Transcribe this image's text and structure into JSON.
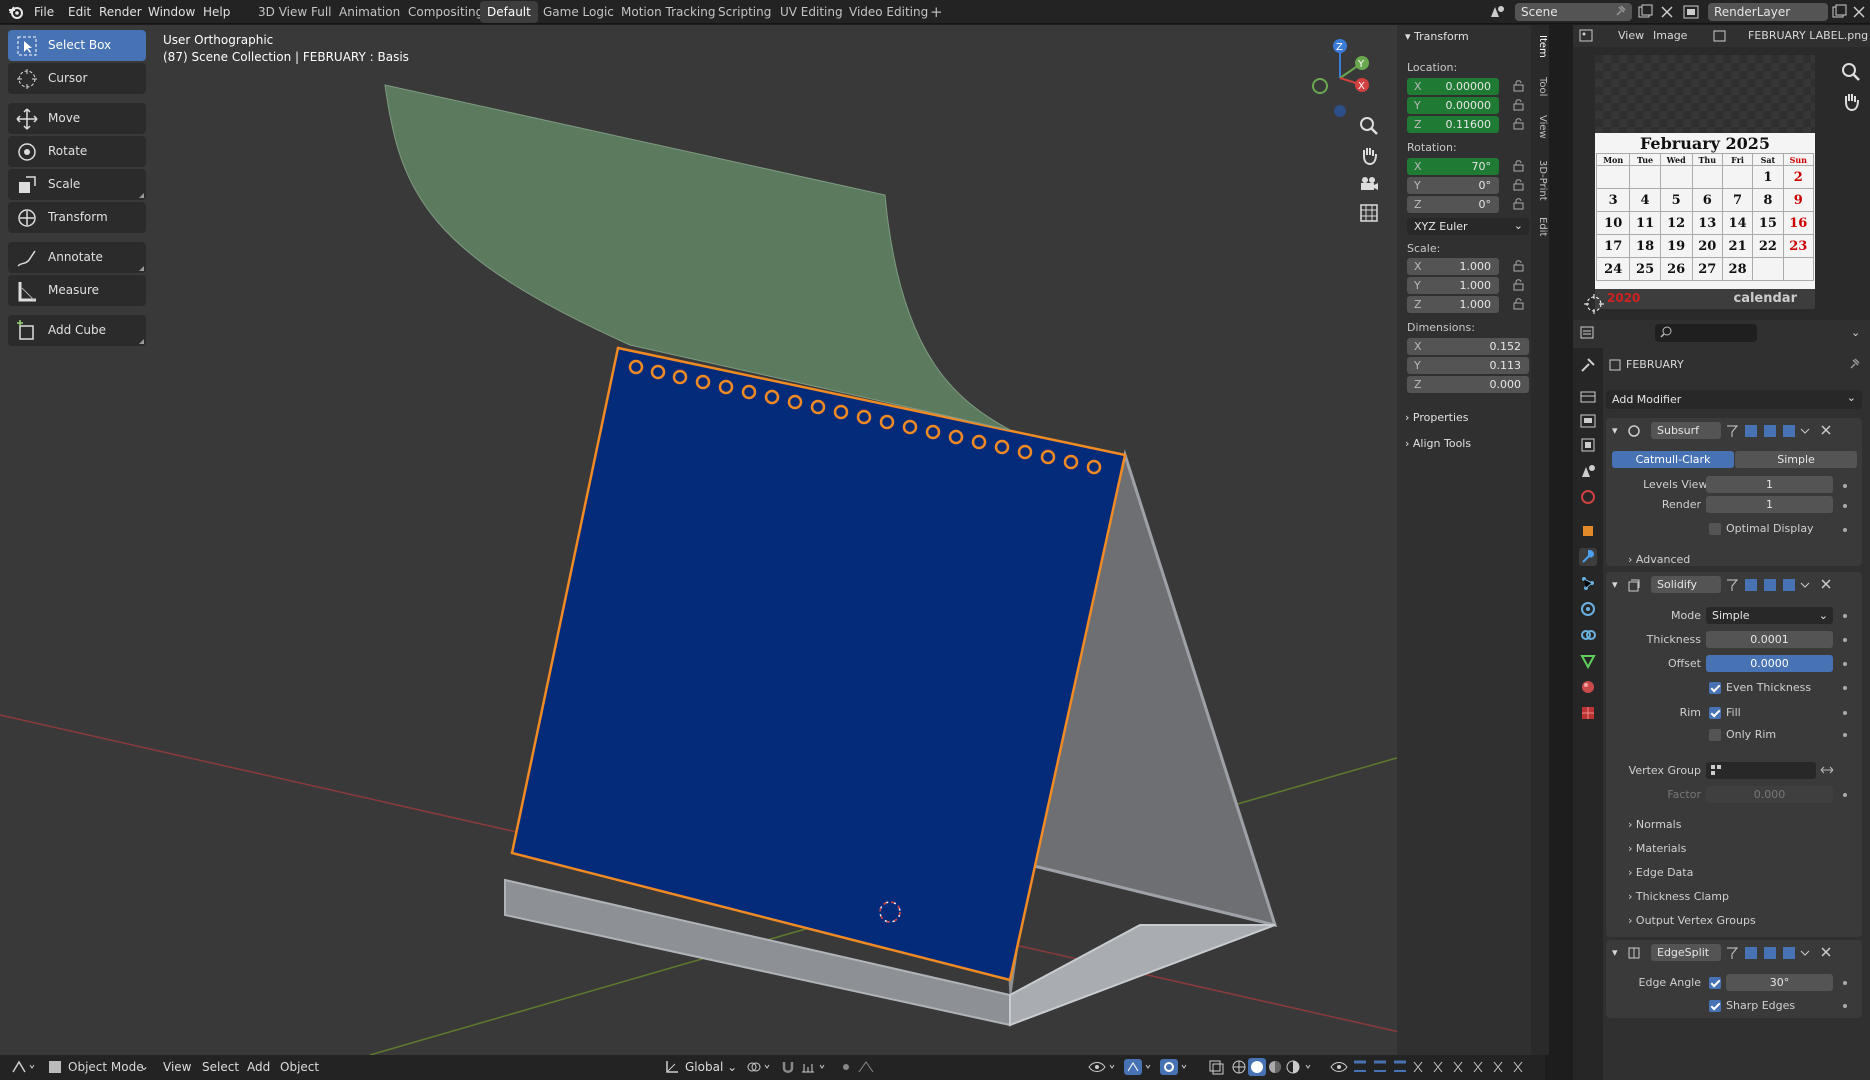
{
  "menubar": {
    "items": [
      "File",
      "Edit",
      "Render",
      "Window",
      "Help"
    ]
  },
  "workspaces": [
    "3D View Full",
    "Animation",
    "Compositing",
    "Default",
    "Game Logic",
    "Motion Tracking",
    "Scripting",
    "UV Editing",
    "Video Editing"
  ],
  "active_workspace": "Default",
  "scene": {
    "name": "Scene",
    "render_layer": "RenderLayer"
  },
  "viewport": {
    "view_name": "User Orthographic",
    "context": "(87) Scene Collection | FEBRUARY : Basis"
  },
  "tools": [
    "Select Box",
    "Cursor",
    "Move",
    "Rotate",
    "Scale",
    "Transform",
    "Annotate",
    "Measure",
    "Add Cube"
  ],
  "transform": {
    "header": "Transform",
    "location_label": "Location:",
    "location": {
      "x": "0.00000",
      "y": "0.00000",
      "z": "0.11600"
    },
    "rotation_label": "Rotation:",
    "rotation": {
      "x": "70°",
      "y": "0°",
      "z": "0°"
    },
    "rotation_mode": "XYZ Euler",
    "scale_label": "Scale:",
    "scale": {
      "x": "1.000",
      "y": "1.000",
      "z": "1.000"
    },
    "dimensions_label": "Dimensions:",
    "dimensions": {
      "x": "0.152",
      "y": "0.113",
      "z": "0.000"
    },
    "axis": {
      "x": "X",
      "y": "Y",
      "z": "Z"
    }
  },
  "npanel_sections": [
    "Properties",
    "Align Tools"
  ],
  "npanel_tabs": [
    "Item",
    "Tool",
    "View",
    "3D-Print",
    "Edit"
  ],
  "image_editor": {
    "view": "View",
    "image": "Image",
    "filename": "FEBRUARY LABEL.png"
  },
  "calendar": {
    "title": "February 2025",
    "weekdays": [
      "Mon",
      "Tue",
      "Wed",
      "Thu",
      "Fri",
      "Sat",
      "Sun"
    ],
    "weeks": [
      [
        "",
        "",
        "",
        "",
        "",
        "1",
        "2"
      ],
      [
        "3",
        "4",
        "5",
        "6",
        "7",
        "8",
        "9"
      ],
      [
        "10",
        "11",
        "12",
        "13",
        "14",
        "15",
        "16"
      ],
      [
        "17",
        "18",
        "19",
        "20",
        "21",
        "22",
        "23"
      ],
      [
        "24",
        "25",
        "26",
        "27",
        "28",
        "",
        ""
      ]
    ],
    "footer": "calendar",
    "corner_text": "2020"
  },
  "properties": {
    "object_name": "FEBRUARY",
    "add_modifier": "Add Modifier",
    "subsurf": {
      "name": "Subsurf",
      "tab_a": "Catmull-Clark",
      "tab_b": "Simple",
      "levels_label": "Levels Viewport",
      "levels": "1",
      "render_label": "Render",
      "render": "1",
      "optimal": "Optimal Display",
      "advanced": "Advanced"
    },
    "solidify": {
      "name": "Solidify",
      "mode_label": "Mode",
      "mode": "Simple",
      "thickness_label": "Thickness",
      "thickness": "0.0001",
      "offset_label": "Offset",
      "offset": "0.0000",
      "even": "Even Thickness",
      "rim_label": "Rim",
      "fill": "Fill",
      "only_rim": "Only Rim",
      "vgroup_label": "Vertex Group",
      "factor_label": "Factor",
      "factor": "0.000",
      "subpanels": [
        "Normals",
        "Materials",
        "Edge Data",
        "Thickness Clamp",
        "Output Vertex Groups"
      ]
    },
    "edgesplit": {
      "name": "EdgeSplit",
      "angle_label": "Edge Angle",
      "angle": "30°",
      "sharp": "Sharp Edges"
    }
  },
  "bottombar": {
    "mode": "Object Mode",
    "menus": [
      "View",
      "Select",
      "Add",
      "Object"
    ],
    "orientation": "Global"
  },
  "colors": {
    "accent": "#4772b3",
    "location_green": "#1f7a33",
    "calendar_blue": "#042a7a",
    "selection_orange": "#f08a24"
  }
}
